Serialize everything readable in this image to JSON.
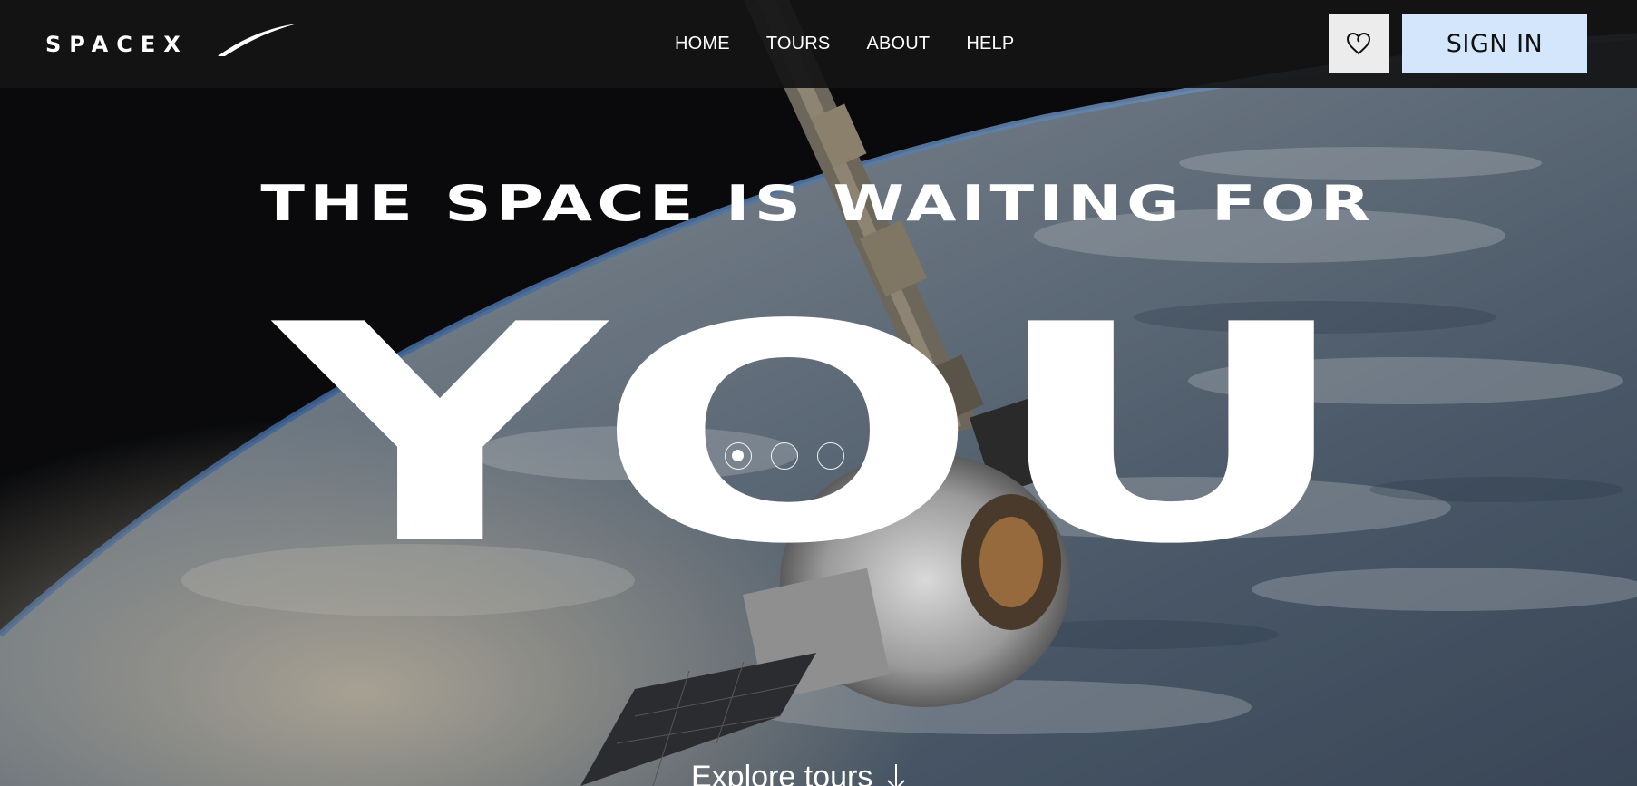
{
  "header": {
    "logo_text": "SPACEX",
    "nav": [
      {
        "label": "HOME"
      },
      {
        "label": "TOURS"
      },
      {
        "label": "ABOUT"
      },
      {
        "label": "HELP"
      }
    ],
    "favorites_icon": "heart-icon",
    "signin_label": "SIGN IN"
  },
  "hero": {
    "headline_top": "THE SPACE IS WAITING FOR",
    "headline_big": "YOU",
    "slides": {
      "count": 3,
      "active_index": 0
    }
  },
  "explore": {
    "label": "Explore tours",
    "icon": "arrow-down-icon"
  },
  "colors": {
    "header_bg": "#141416",
    "signin_bg": "#d3e6fb",
    "favorites_bg": "#ececec",
    "text": "#ffffff"
  }
}
